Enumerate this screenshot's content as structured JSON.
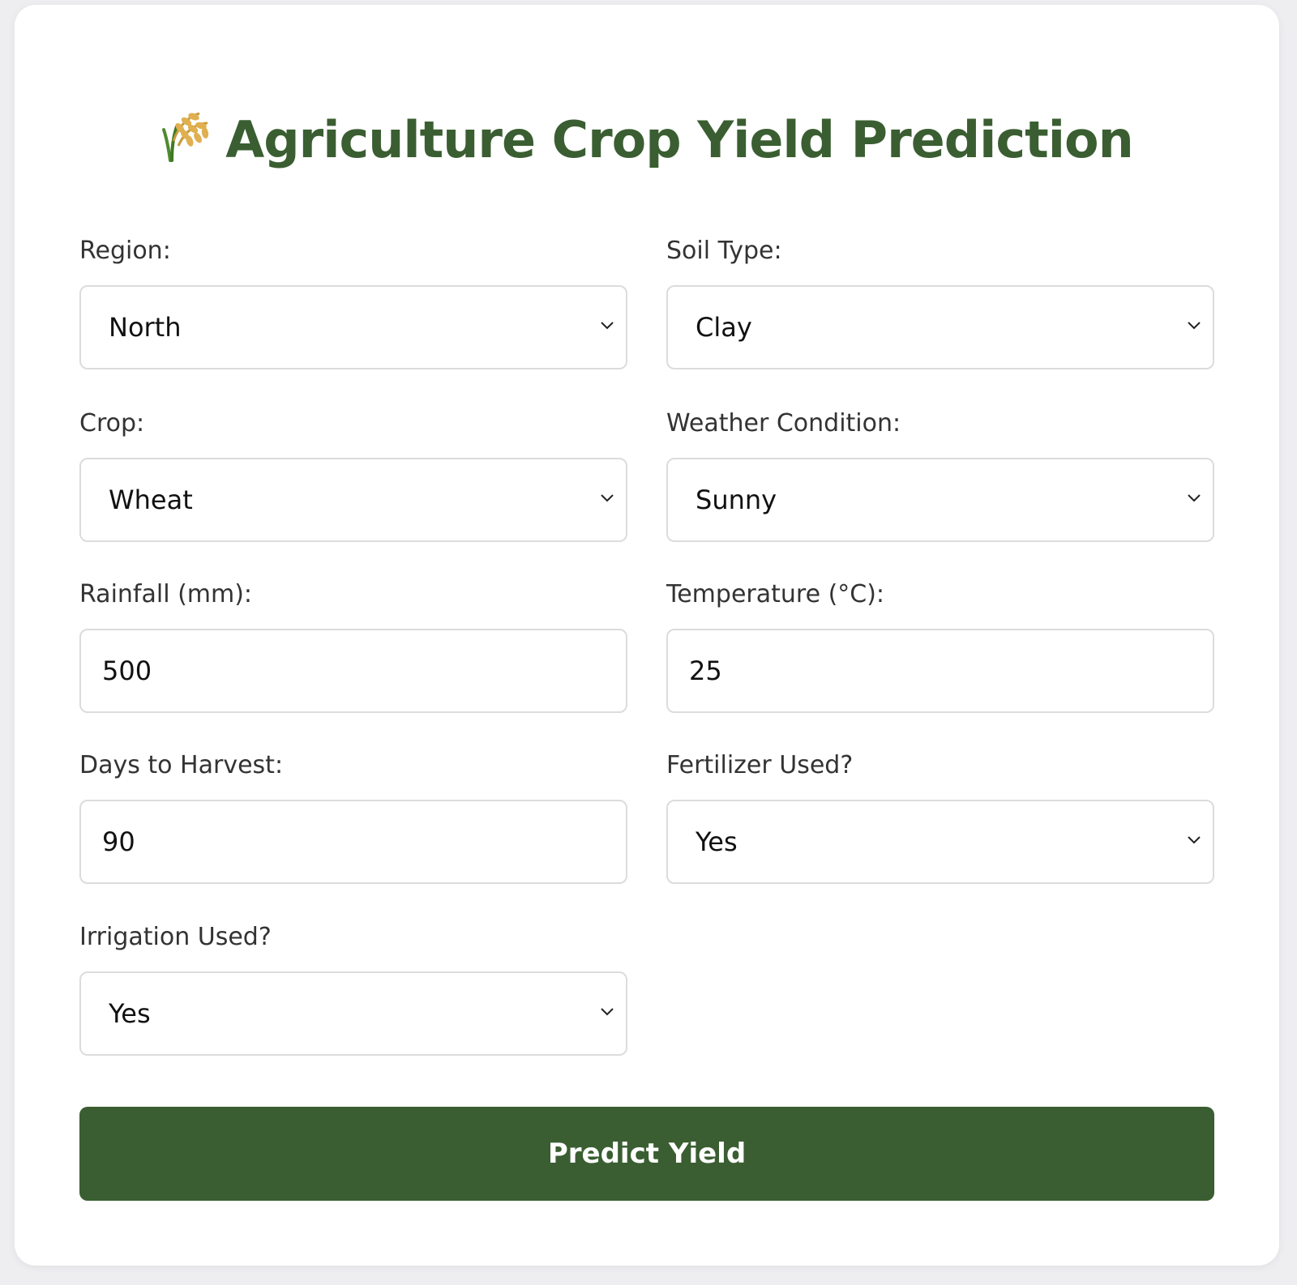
{
  "header": {
    "title": "Agriculture Crop Yield Prediction",
    "icon": "rice-sheaf-icon"
  },
  "form": {
    "region": {
      "label": "Region:",
      "value": "North"
    },
    "soil_type": {
      "label": "Soil Type:",
      "value": "Clay"
    },
    "crop": {
      "label": "Crop:",
      "value": "Wheat"
    },
    "weather": {
      "label": "Weather Condition:",
      "value": "Sunny"
    },
    "rainfall": {
      "label": "Rainfall (mm):",
      "value": "500"
    },
    "temperature": {
      "label": "Temperature (°C):",
      "value": "25"
    },
    "days_to_harvest": {
      "label": "Days to Harvest:",
      "value": "90"
    },
    "fertilizer": {
      "label": "Fertilizer Used?",
      "value": "Yes"
    },
    "irrigation": {
      "label": "Irrigation Used?",
      "value": "Yes"
    },
    "submit_label": "Predict Yield"
  },
  "colors": {
    "accent": "#3a5e31",
    "background": "#eeeef1",
    "card": "#ffffff",
    "border": "#dcdcdc"
  }
}
